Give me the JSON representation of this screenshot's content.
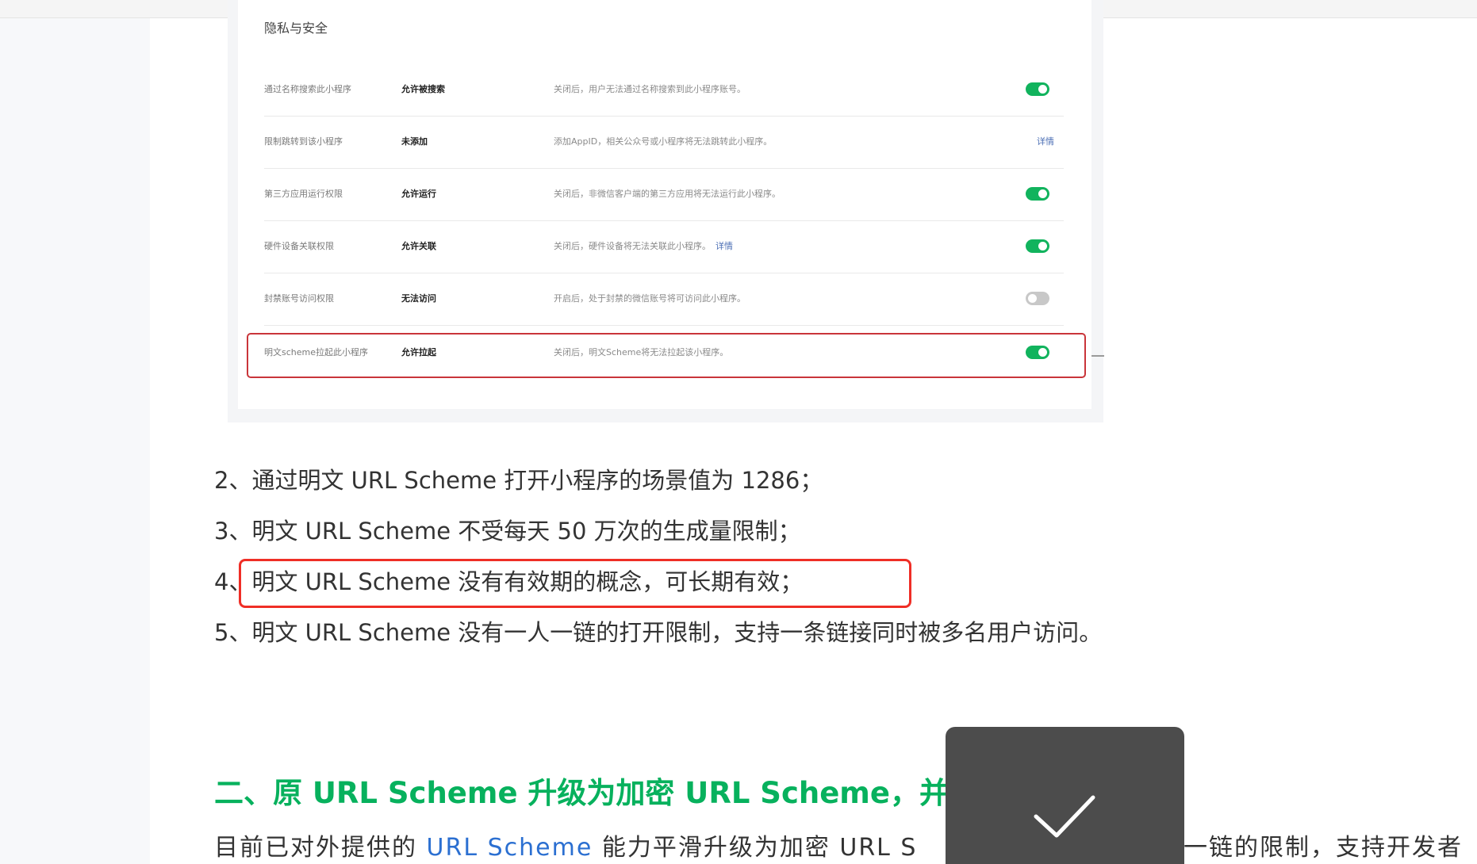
{
  "settings_panel": {
    "title": "隐私与安全",
    "rows": [
      {
        "label": "通过名称搜索此小程序",
        "value": "允许被搜索",
        "desc": "关闭后，用户无法通过名称搜索到此小程序账号。",
        "control": "toggle-on"
      },
      {
        "label": "限制跳转到该小程序",
        "value": "未添加",
        "desc": "添加AppID，相关公众号或小程序将无法跳转此小程序。",
        "link": "详情"
      },
      {
        "label": "第三方应用运行权限",
        "value": "允许运行",
        "desc": "关闭后，非微信客户端的第三方应用将无法运行此小程序。",
        "control": "toggle-on"
      },
      {
        "label": "硬件设备关联权限",
        "value": "允许关联",
        "desc": "关闭后，硬件设备将无法关联此小程序。",
        "desc_link": "详情",
        "control": "toggle-on"
      },
      {
        "label": "封禁账号访问权限",
        "value": "无法访问",
        "desc": "开启后，处于封禁的微信账号将可访问此小程序。",
        "control": "toggle-off"
      },
      {
        "label": "明文scheme拉起此小程序",
        "value": "允许拉起",
        "desc": "关闭后，明文Scheme将无法拉起该小程序。",
        "control": "toggle-on",
        "highlighted": true
      }
    ]
  },
  "list_items": [
    "2、通过明文 URL Scheme 打开小程序的场景值为 1286；",
    "3、明文 URL Scheme 不受每天 50 万次的生成量限制；",
    "4、明文 URL Scheme 没有有效期的概念，可长期有效；",
    "5、明文 URL Scheme 没有一人一链的打开限制，支持一条链接同时被多名用户访问。"
  ],
  "section_heading": "二、原 URL Scheme 升级为加密 URL Scheme，并支",
  "paragraph": {
    "before": "目前已对外提供的 ",
    "link": "URL Scheme",
    "after": " 能力平滑升级为加密 URL S",
    "tail": "一链的限制，支持开发者"
  },
  "toast": {
    "icon": "checkmark-icon"
  },
  "colors": {
    "accent_green": "#07b15d",
    "toggle_green": "#11b35d",
    "highlight_red": "#ef2e26",
    "link_blue": "#2b6fd1"
  }
}
